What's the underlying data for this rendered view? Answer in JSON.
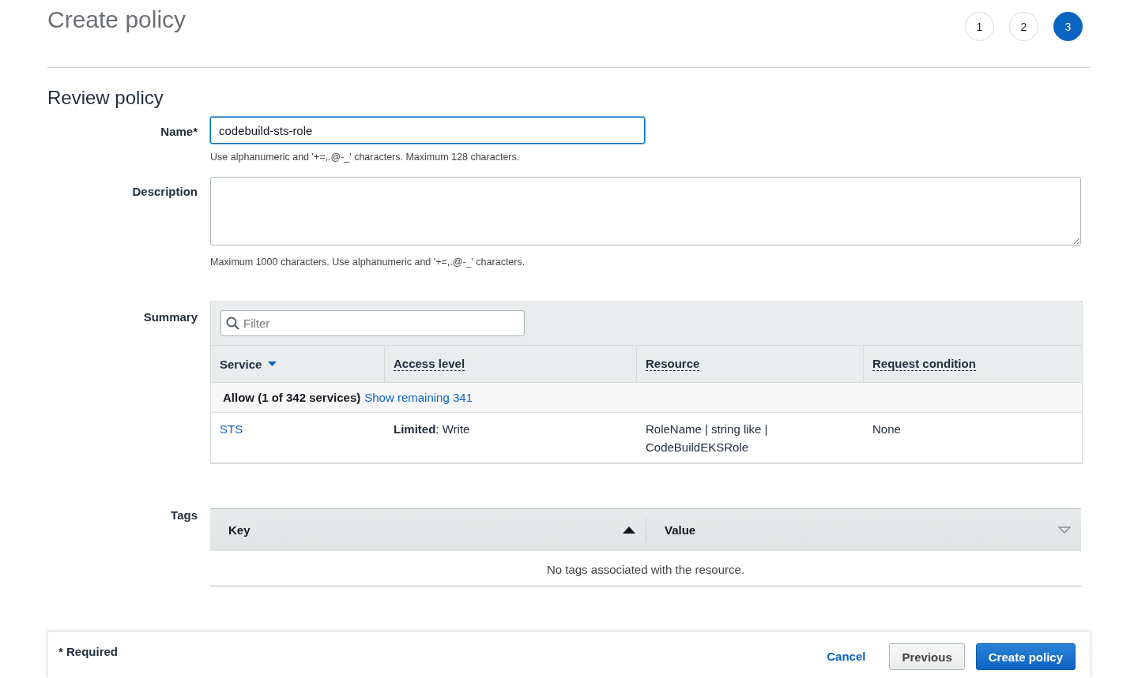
{
  "header": {
    "title": "Create policy",
    "steps": [
      {
        "label": "1",
        "selected": false
      },
      {
        "label": "2",
        "selected": false
      },
      {
        "label": "3",
        "selected": true
      }
    ]
  },
  "section_title": "Review policy",
  "name_field": {
    "label": "Name*",
    "value": "codebuild-sts-role",
    "hint": "Use alphanumeric and '+=,.@-_' characters. Maximum 128 characters."
  },
  "description_field": {
    "label": "Description",
    "hint": "Maximum 1000 characters. Use alphanumeric and '+=,.@-_' characters."
  },
  "summary": {
    "label": "Summary",
    "filter_placeholder": "Filter",
    "columns": [
      {
        "label": "Service",
        "kind": "dropdown"
      },
      {
        "label": "Access level",
        "kind": "tooltip"
      },
      {
        "label": "Resource",
        "kind": "tooltip"
      },
      {
        "label": "Request condition",
        "kind": "tooltip"
      }
    ],
    "group": {
      "label": "Allow (1 of 342 services)",
      "link": "Show remaining 341"
    },
    "rows": [
      {
        "service": "STS",
        "access_level": "**Limited**: Write",
        "resource": "RoleName | string like | CodeBuildEKSRole",
        "condition": "None"
      }
    ]
  },
  "tags": {
    "label": "Tags",
    "columns": [
      {
        "label": "Key",
        "sorted": true
      },
      {
        "label": "Value",
        "sorted": false
      }
    ],
    "empty": "No tags associated with the resource."
  },
  "footer": {
    "required_note": "* Required",
    "cancel": "Cancel",
    "previous": "Previous",
    "submit": "Create policy"
  }
}
